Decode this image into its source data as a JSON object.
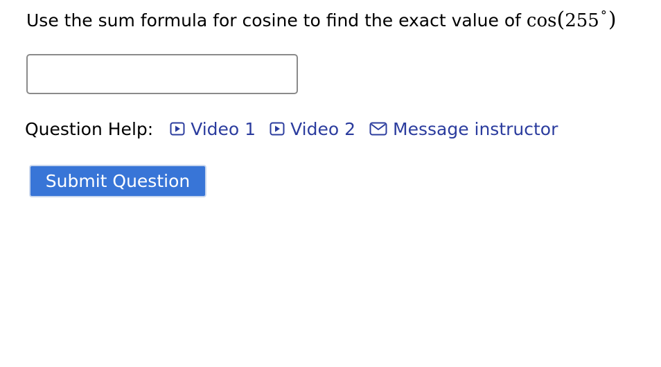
{
  "question": {
    "text": "Use the sum formula for cosine to find the exact value of",
    "math_func": "cos",
    "math_open": "(",
    "math_value": "255",
    "math_degree": "°",
    "math_close": ")"
  },
  "answer": {
    "value": "",
    "placeholder": ""
  },
  "help": {
    "label": "Question Help:",
    "links": [
      {
        "label": "Video 1",
        "icon": "video-play-icon"
      },
      {
        "label": "Video 2",
        "icon": "video-play-icon"
      },
      {
        "label": "Message instructor",
        "icon": "envelope-icon"
      }
    ]
  },
  "submit": {
    "label": "Submit Question",
    "color": "#3875d7"
  },
  "colors": {
    "link": "#2b3c9e",
    "input_border": "#8a8a8a"
  }
}
